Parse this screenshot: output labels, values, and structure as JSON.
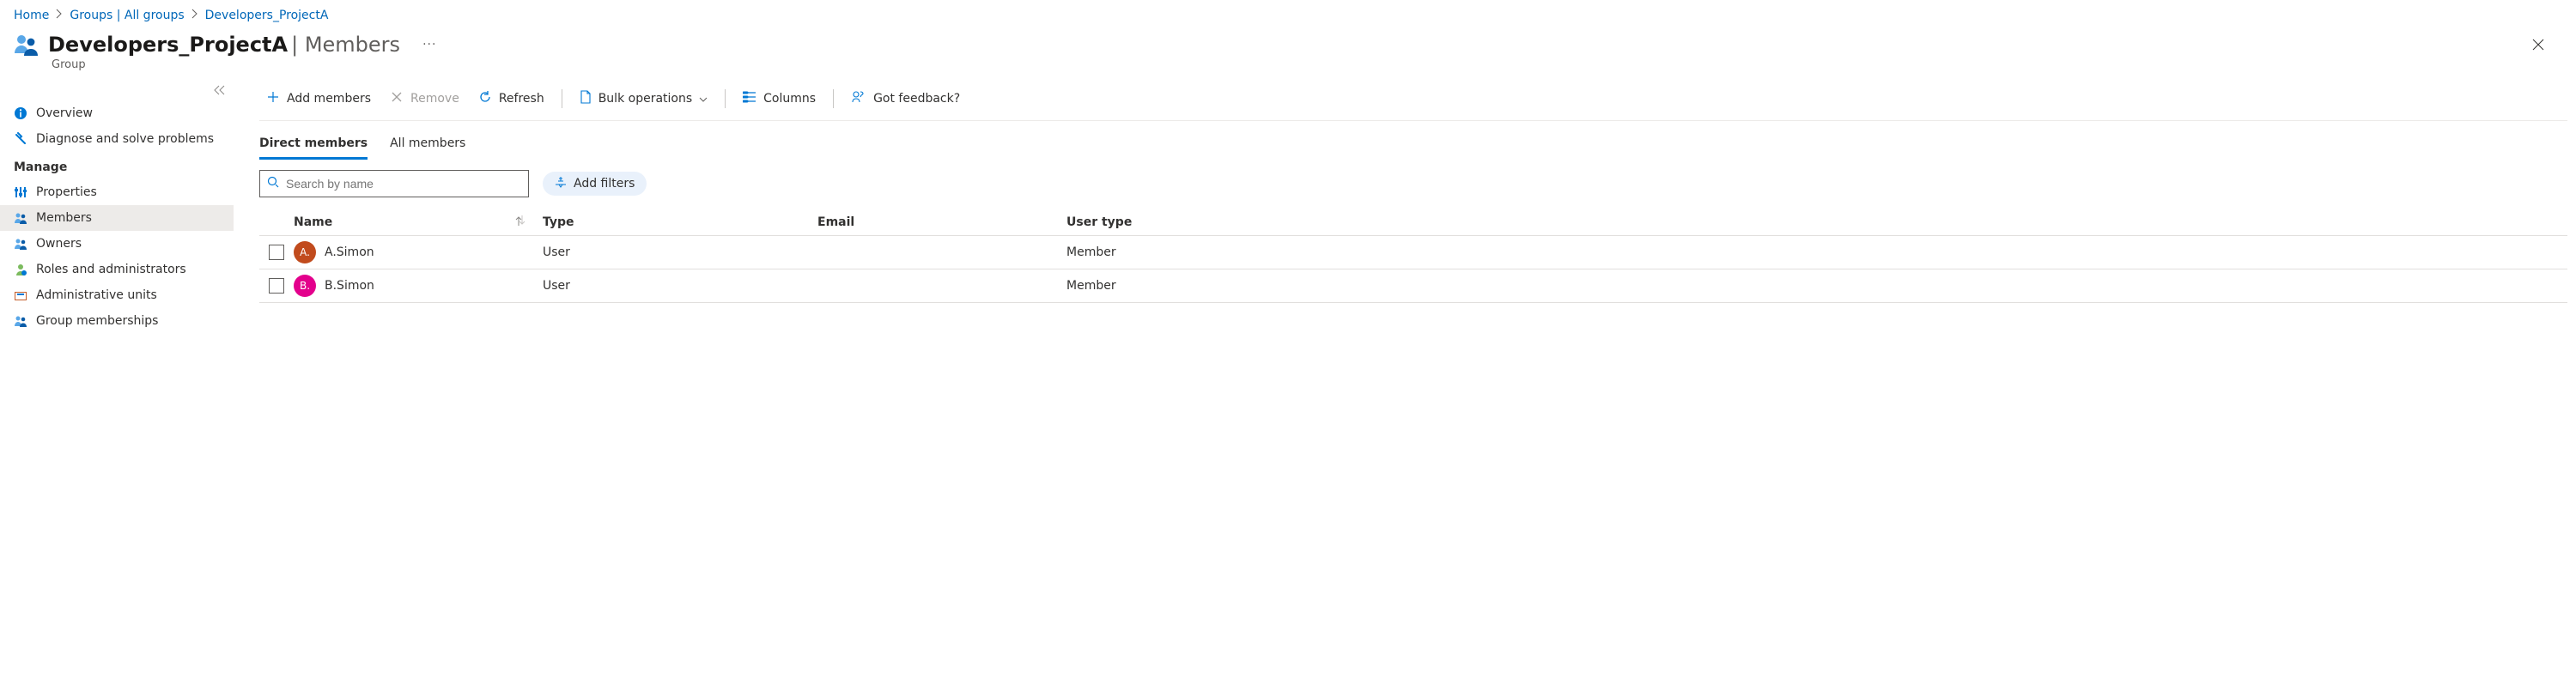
{
  "breadcrumb": [
    {
      "label": "Home"
    },
    {
      "label": "Groups | All groups"
    },
    {
      "label": "Developers_ProjectA"
    }
  ],
  "header": {
    "title_strong": "Developers_ProjectA",
    "title_sep": " | ",
    "title_light": "Members",
    "subtitle": "Group"
  },
  "sidebar": {
    "top": [
      {
        "label": "Overview",
        "name": "sidebar-item-overview"
      },
      {
        "label": "Diagnose and solve problems",
        "name": "sidebar-item-diagnose"
      }
    ],
    "section": "Manage",
    "manage": [
      {
        "label": "Properties",
        "name": "sidebar-item-properties"
      },
      {
        "label": "Members",
        "name": "sidebar-item-members"
      },
      {
        "label": "Owners",
        "name": "sidebar-item-owners"
      },
      {
        "label": "Roles and administrators",
        "name": "sidebar-item-roles-admins"
      },
      {
        "label": "Administrative units",
        "name": "sidebar-item-admin-units"
      },
      {
        "label": "Group memberships",
        "name": "sidebar-item-group-memberships"
      }
    ]
  },
  "commands": {
    "add_members": "Add members",
    "remove": "Remove",
    "refresh": "Refresh",
    "bulk_operations": "Bulk operations",
    "columns": "Columns",
    "feedback": "Got feedback?"
  },
  "tabs": {
    "direct": "Direct members",
    "all": "All members"
  },
  "search": {
    "placeholder": "Search by name"
  },
  "filters": {
    "add": "Add filters"
  },
  "table": {
    "headers": {
      "name": "Name",
      "type": "Type",
      "email": "Email",
      "user_type": "User type"
    },
    "rows": [
      {
        "initials": "A.",
        "name": "A.Simon",
        "type": "User",
        "email": "",
        "user_type": "Member",
        "color": "#c14b1d"
      },
      {
        "initials": "B.",
        "name": "B.Simon",
        "type": "User",
        "email": "",
        "user_type": "Member",
        "color": "#e3008c"
      }
    ]
  }
}
